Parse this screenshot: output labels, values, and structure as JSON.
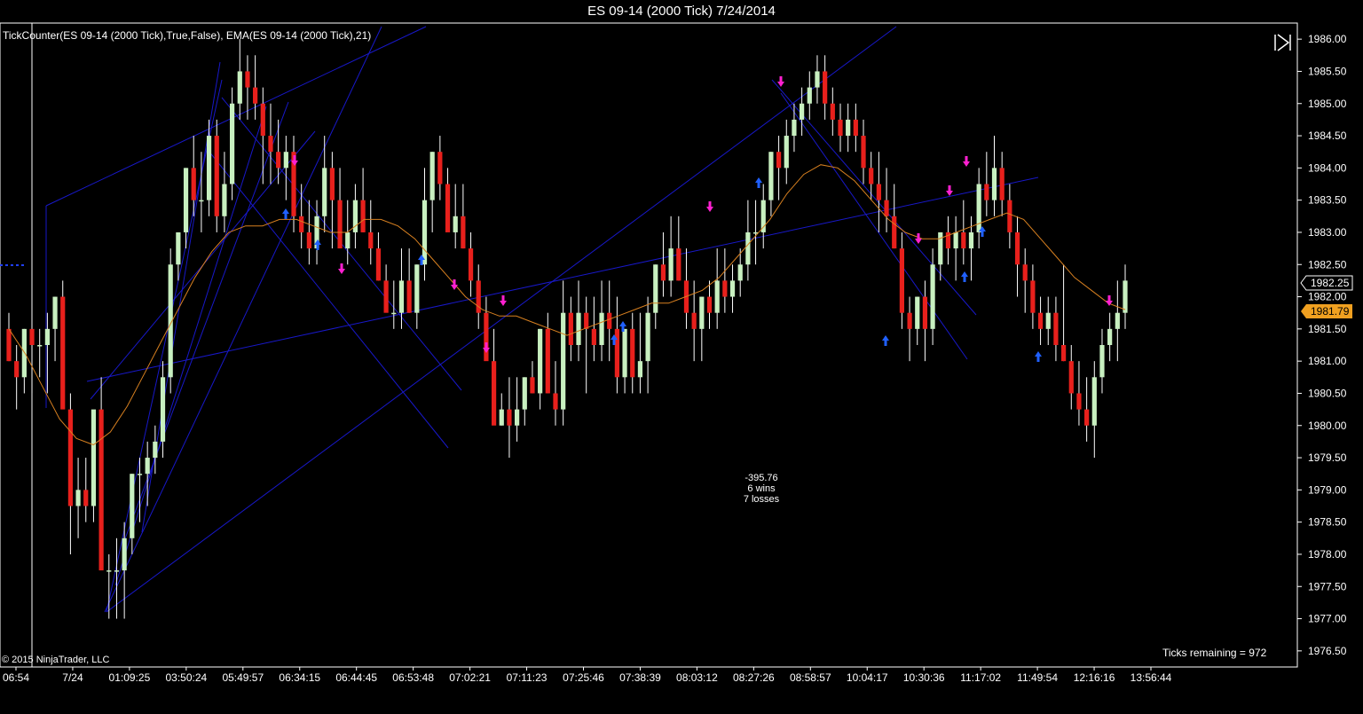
{
  "window": {
    "title": "ES 09-14 (2000 Tick)  7/24/2014"
  },
  "header": {
    "indicator_label": "TickCounter(ES 09-14 (2000 Tick),True,False),  EMA(ES 09-14 (2000 Tick),21)"
  },
  "footer": {
    "copyright": "© 2015 NinjaTrader, LLC",
    "ticks_remaining": "Ticks remaining = 972"
  },
  "stats": {
    "pnl": "-395.76",
    "wins": "6 wins",
    "losses": "7 losses"
  },
  "price_tags": {
    "last": "1982.25",
    "ema": "1981.79"
  },
  "colors": {
    "up": "#c8f0c0",
    "down": "#e8201c",
    "ema": "#d88020",
    "channel": "#1818c8",
    "grid": "#ffffff",
    "buy_arrow": "#2060ff",
    "sell_arrow": "#ff20d0",
    "ema_tag": "#f0a020"
  },
  "icons": {
    "scroll": "scroll-end-icon"
  },
  "chart_data": {
    "type": "candlestick",
    "ylim": [
      1976.25,
      1986.25
    ],
    "y_ticks": [
      1976.5,
      1977.0,
      1977.5,
      1978.0,
      1978.5,
      1979.0,
      1979.5,
      1980.0,
      1980.5,
      1981.0,
      1981.5,
      1982.0,
      1982.5,
      1983.0,
      1983.5,
      1984.0,
      1984.5,
      1985.0,
      1985.5,
      1986.0
    ],
    "x_labels": [
      "06:54",
      "7/24",
      "01:09:25",
      "03:50:24",
      "05:49:57",
      "06:34:15",
      "06:44:45",
      "06:53:48",
      "07:02:21",
      "07:11:23",
      "07:25:46",
      "07:38:39",
      "08:03:12",
      "08:27:26",
      "08:58:57",
      "10:04:17",
      "10:30:36",
      "11:17:02",
      "11:49:54",
      "12:16:16",
      "13:56:44"
    ],
    "candles": [
      [
        1981.5,
        1981.75,
        1981.0,
        1981.0
      ],
      [
        1981.0,
        1981.25,
        1980.25,
        1980.75
      ],
      [
        1980.75,
        1981.5,
        1980.5,
        1981.5
      ],
      [
        1981.5,
        1981.5,
        1980.5,
        1981.25
      ],
      [
        1981.25,
        1981.5,
        1980.75,
        1981.25
      ],
      [
        1981.25,
        1981.75,
        1980.5,
        1981.5
      ],
      [
        1981.5,
        1982.0,
        1981.0,
        1982.0
      ],
      [
        1982.0,
        1982.25,
        1980.5,
        1980.25
      ],
      [
        1980.25,
        1980.5,
        1978.0,
        1978.75
      ],
      [
        1978.75,
        1979.5,
        1978.25,
        1979.0
      ],
      [
        1979.0,
        1979.5,
        1978.5,
        1978.75
      ],
      [
        1978.75,
        1979.5,
        1978.5,
        1980.25
      ],
      [
        1980.25,
        1980.75,
        1978.0,
        1977.75
      ],
      [
        1977.75,
        1978.0,
        1977.0,
        1977.75
      ],
      [
        1977.75,
        1978.25,
        1977.0,
        1977.75
      ],
      [
        1977.75,
        1978.5,
        1977.0,
        1978.25
      ],
      [
        1978.25,
        1979.25,
        1978.0,
        1979.25
      ],
      [
        1979.25,
        1979.5,
        1978.5,
        1979.25
      ],
      [
        1979.25,
        1979.75,
        1978.75,
        1979.5
      ],
      [
        1979.5,
        1980.0,
        1979.25,
        1979.75
      ],
      [
        1979.75,
        1981.0,
        1979.5,
        1980.75
      ],
      [
        1980.75,
        1982.75,
        1980.5,
        1982.5
      ],
      [
        1982.5,
        1983.0,
        1982.25,
        1983.0
      ],
      [
        1983.0,
        1984.0,
        1982.75,
        1984.0
      ],
      [
        1984.0,
        1984.5,
        1983.25,
        1983.5
      ],
      [
        1983.5,
        1984.25,
        1983.0,
        1983.5
      ],
      [
        1983.5,
        1984.75,
        1983.25,
        1984.5
      ],
      [
        1984.5,
        1984.75,
        1983.0,
        1983.25
      ],
      [
        1983.25,
        1984.25,
        1983.0,
        1983.75
      ],
      [
        1983.75,
        1985.25,
        1983.5,
        1985.0
      ],
      [
        1985.0,
        1986.0,
        1984.75,
        1985.5
      ],
      [
        1985.5,
        1985.75,
        1984.75,
        1985.25
      ],
      [
        1985.25,
        1985.75,
        1984.75,
        1985.0
      ],
      [
        1985.0,
        1985.25,
        1983.75,
        1984.5
      ],
      [
        1984.5,
        1985.0,
        1983.75,
        1984.25
      ],
      [
        1984.25,
        1984.75,
        1983.75,
        1984.0
      ],
      [
        1984.0,
        1984.5,
        1983.5,
        1984.25
      ],
      [
        1984.25,
        1984.5,
        1983.0,
        1983.25
      ],
      [
        1983.25,
        1983.75,
        1982.75,
        1983.0
      ],
      [
        1983.0,
        1983.5,
        1982.5,
        1982.75
      ],
      [
        1982.75,
        1983.5,
        1982.5,
        1983.25
      ],
      [
        1983.25,
        1984.5,
        1983.0,
        1984.0
      ],
      [
        1984.0,
        1984.25,
        1982.75,
        1983.5
      ],
      [
        1983.5,
        1984.0,
        1983.0,
        1982.75
      ],
      [
        1982.75,
        1983.5,
        1982.5,
        1983.0
      ],
      [
        1983.0,
        1983.75,
        1982.75,
        1983.5
      ],
      [
        1983.5,
        1984.0,
        1983.0,
        1983.0
      ],
      [
        1983.0,
        1983.5,
        1982.5,
        1982.75
      ],
      [
        1982.75,
        1983.0,
        1982.25,
        1982.25
      ],
      [
        1982.25,
        1982.5,
        1982.0,
        1981.75
      ],
      [
        1981.75,
        1982.25,
        1981.5,
        1981.75
      ],
      [
        1981.75,
        1982.75,
        1981.5,
        1982.25
      ],
      [
        1982.25,
        1982.75,
        1981.75,
        1981.75
      ],
      [
        1981.75,
        1982.5,
        1981.5,
        1982.5
      ],
      [
        1982.5,
        1984.0,
        1982.25,
        1983.5
      ],
      [
        1983.5,
        1984.25,
        1983.0,
        1984.25
      ],
      [
        1984.25,
        1984.5,
        1983.5,
        1983.75
      ],
      [
        1983.75,
        1984.0,
        1983.25,
        1983.0
      ],
      [
        1983.0,
        1983.75,
        1982.75,
        1983.25
      ],
      [
        1983.25,
        1983.75,
        1982.75,
        1982.75
      ],
      [
        1982.75,
        1983.0,
        1982.0,
        1982.25
      ],
      [
        1982.25,
        1982.5,
        1981.5,
        1981.75
      ],
      [
        1981.75,
        1982.0,
        1981.25,
        1981.0
      ],
      [
        1981.0,
        1981.5,
        1980.25,
        1980.0
      ],
      [
        1980.0,
        1980.5,
        1980.0,
        1980.25
      ],
      [
        1980.25,
        1980.75,
        1979.5,
        1980.0
      ],
      [
        1980.0,
        1980.75,
        1979.75,
        1980.25
      ],
      [
        1980.25,
        1980.75,
        1980.0,
        1980.75
      ],
      [
        1980.75,
        1981.0,
        1980.5,
        1980.5
      ],
      [
        1980.5,
        1981.5,
        1980.25,
        1981.5
      ],
      [
        1981.5,
        1981.75,
        1980.5,
        1980.5
      ],
      [
        1980.5,
        1981.0,
        1980.0,
        1980.25
      ],
      [
        1980.25,
        1982.25,
        1980.0,
        1981.75
      ],
      [
        1981.75,
        1982.0,
        1981.0,
        1981.25
      ],
      [
        1981.25,
        1982.25,
        1981.0,
        1981.75
      ],
      [
        1981.75,
        1982.0,
        1980.5,
        1981.5
      ],
      [
        1981.5,
        1982.0,
        1981.0,
        1981.25
      ],
      [
        1981.25,
        1982.25,
        1981.0,
        1981.75
      ],
      [
        1981.75,
        1982.25,
        1981.0,
        1981.5
      ],
      [
        1981.5,
        1982.0,
        1980.5,
        1980.75
      ],
      [
        1980.75,
        1981.25,
        1980.5,
        1981.5
      ],
      [
        1981.5,
        1981.75,
        1980.5,
        1980.75
      ],
      [
        1980.75,
        1981.75,
        1980.5,
        1981.0
      ],
      [
        1981.0,
        1982.0,
        1980.5,
        1981.75
      ],
      [
        1981.75,
        1982.5,
        1981.5,
        1982.5
      ],
      [
        1982.5,
        1983.0,
        1982.0,
        1982.25
      ],
      [
        1982.25,
        1983.25,
        1982.0,
        1982.75
      ],
      [
        1982.75,
        1983.25,
        1982.25,
        1982.25
      ],
      [
        1982.25,
        1982.75,
        1981.5,
        1981.75
      ],
      [
        1981.75,
        1982.25,
        1981.0,
        1981.5
      ],
      [
        1981.5,
        1982.0,
        1981.0,
        1982.0
      ],
      [
        1982.0,
        1982.25,
        1981.5,
        1981.75
      ],
      [
        1981.75,
        1982.75,
        1981.5,
        1982.25
      ],
      [
        1982.25,
        1982.75,
        1981.75,
        1982.0
      ],
      [
        1982.0,
        1982.5,
        1981.75,
        1982.25
      ],
      [
        1982.25,
        1982.75,
        1982.0,
        1982.5
      ],
      [
        1982.5,
        1983.5,
        1982.25,
        1983.0
      ],
      [
        1983.0,
        1983.5,
        1982.5,
        1983.0
      ],
      [
        1983.0,
        1983.75,
        1982.75,
        1983.5
      ],
      [
        1983.5,
        1984.25,
        1983.25,
        1984.25
      ],
      [
        1984.25,
        1984.5,
        1983.5,
        1984.0
      ],
      [
        1984.0,
        1984.75,
        1983.75,
        1984.5
      ],
      [
        1984.5,
        1985.0,
        1984.25,
        1984.75
      ],
      [
        1984.75,
        1985.25,
        1984.5,
        1985.0
      ],
      [
        1985.0,
        1985.5,
        1984.75,
        1985.25
      ],
      [
        1985.25,
        1985.75,
        1985.0,
        1985.5
      ],
      [
        1985.5,
        1985.75,
        1984.75,
        1985.0
      ],
      [
        1985.0,
        1985.25,
        1984.5,
        1984.75
      ],
      [
        1984.75,
        1985.0,
        1984.25,
        1984.5
      ],
      [
        1984.5,
        1985.0,
        1984.25,
        1984.75
      ],
      [
        1984.75,
        1985.0,
        1984.25,
        1984.5
      ],
      [
        1984.5,
        1984.75,
        1983.75,
        1984.0
      ],
      [
        1984.0,
        1984.25,
        1983.5,
        1983.75
      ],
      [
        1983.75,
        1984.25,
        1983.0,
        1983.5
      ],
      [
        1983.5,
        1984.0,
        1983.0,
        1983.25
      ],
      [
        1983.25,
        1983.75,
        1982.75,
        1982.75
      ],
      [
        1982.75,
        1983.0,
        1981.5,
        1981.75
      ],
      [
        1981.75,
        1982.0,
        1981.0,
        1981.5
      ],
      [
        1981.5,
        1982.0,
        1981.25,
        1982.0
      ],
      [
        1982.0,
        1982.25,
        1981.0,
        1981.5
      ],
      [
        1981.5,
        1982.75,
        1981.25,
        1982.5
      ],
      [
        1982.5,
        1983.0,
        1982.25,
        1983.0
      ],
      [
        1983.0,
        1983.25,
        1982.5,
        1982.75
      ],
      [
        1982.75,
        1983.25,
        1982.25,
        1983.0
      ],
      [
        1983.0,
        1983.5,
        1982.5,
        1982.75
      ],
      [
        1982.75,
        1983.25,
        1982.25,
        1983.0
      ],
      [
        1983.0,
        1984.0,
        1982.75,
        1983.75
      ],
      [
        1983.75,
        1984.25,
        1983.25,
        1983.5
      ],
      [
        1983.5,
        1984.5,
        1983.25,
        1984.0
      ],
      [
        1984.0,
        1984.25,
        1983.25,
        1983.5
      ],
      [
        1983.5,
        1983.75,
        1982.75,
        1983.0
      ],
      [
        1983.0,
        1983.25,
        1982.0,
        1982.5
      ],
      [
        1982.5,
        1982.75,
        1981.75,
        1982.25
      ],
      [
        1982.25,
        1982.5,
        1981.5,
        1981.75
      ],
      [
        1981.75,
        1982.0,
        1981.25,
        1981.5
      ],
      [
        1981.5,
        1982.0,
        1981.25,
        1981.75
      ],
      [
        1981.75,
        1982.0,
        1981.0,
        1981.25
      ],
      [
        1981.25,
        1982.5,
        1981.0,
        1981.0
      ],
      [
        1981.0,
        1981.25,
        1980.25,
        1980.5
      ],
      [
        1980.5,
        1981.0,
        1980.0,
        1980.25
      ],
      [
        1980.25,
        1980.75,
        1979.75,
        1980.0
      ],
      [
        1980.0,
        1981.0,
        1979.5,
        1980.75
      ],
      [
        1980.75,
        1981.5,
        1980.5,
        1981.25
      ],
      [
        1981.25,
        1981.75,
        1981.0,
        1981.5
      ],
      [
        1981.5,
        1982.25,
        1981.0,
        1981.75
      ],
      [
        1981.75,
        1982.5,
        1981.5,
        1982.25
      ]
    ],
    "ema": [
      1981.5,
      1981.1,
      1980.6,
      1980.1,
      1979.8,
      1979.7,
      1979.9,
      1980.3,
      1980.8,
      1981.3,
      1981.8,
      1982.3,
      1982.7,
      1983.0,
      1983.1,
      1983.1,
      1983.2,
      1983.2,
      1983.1,
      1983.0,
      1983.0,
      1983.2,
      1983.2,
      1983.1,
      1982.9,
      1982.6,
      1982.3,
      1982.0,
      1981.8,
      1981.7,
      1981.7,
      1981.6,
      1981.5,
      1981.4,
      1981.5,
      1981.6,
      1981.7,
      1981.8,
      1981.9,
      1981.9,
      1982.0,
      1982.1,
      1982.3,
      1982.6,
      1982.9,
      1983.2,
      1983.6,
      1983.9,
      1984.05,
      1984.0,
      1983.8,
      1983.5,
      1983.2,
      1983.0,
      1982.9,
      1982.9,
      1983.0,
      1983.1,
      1983.2,
      1983.3,
      1983.2,
      1982.9,
      1982.6,
      1982.3,
      1982.1,
      1981.9,
      1981.8
    ]
  }
}
